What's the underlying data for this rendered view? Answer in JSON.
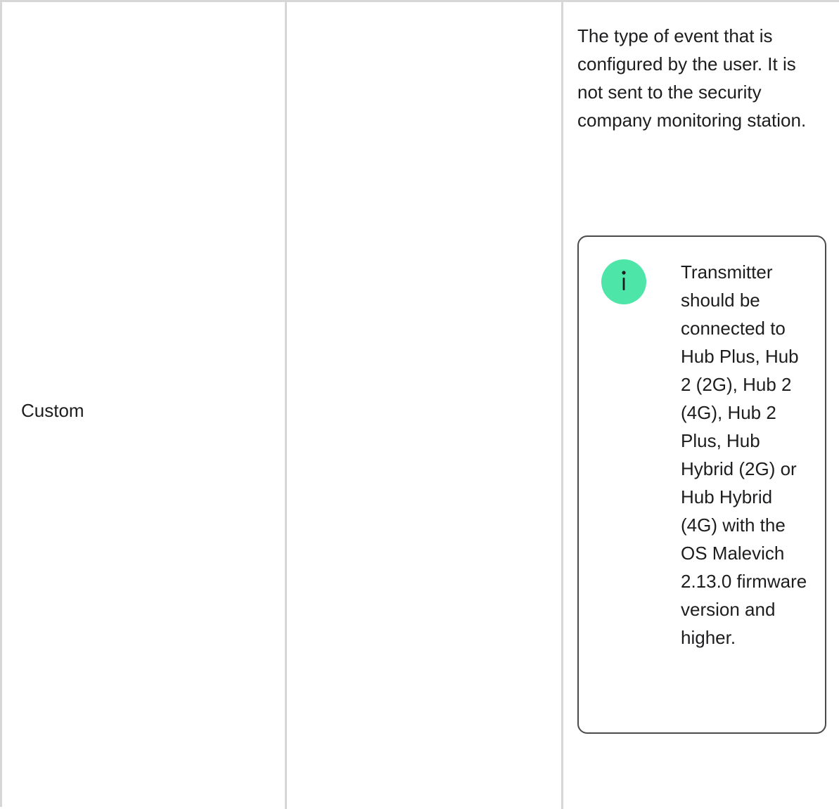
{
  "table": {
    "row": {
      "event_type": "Custom",
      "column2_text": "",
      "description": "The type of event that is configured by the user. It is not sent to the security company monitoring station.",
      "note": {
        "icon": "info-icon",
        "icon_color": "#4ee5a8",
        "text": "Transmitter should be connected to Hub Plus, Hub 2 (2G), Hub 2 (4G), Hub 2 Plus, Hub Hybrid (2G) or Hub Hybrid (4G) with the OS Malevich 2.13.0 firmware version and higher."
      }
    }
  }
}
